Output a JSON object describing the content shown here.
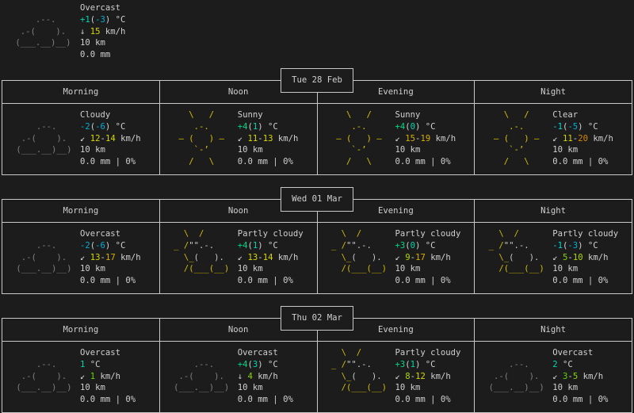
{
  "colors": {
    "background": "#1c1c1c",
    "text": "#d0d0d0",
    "border": "#c8c8c8",
    "cloud": "#808080",
    "sun": "#d7c000"
  },
  "icons": {
    "cloud": {
      "color": "#808080",
      "lines": [
        "             ",
        "     .--.    ",
        "  .-(    ).  ",
        " (___.__)__) ",
        "             "
      ]
    },
    "sun": {
      "color": "#d7c000",
      "lines": [
        "    \\   /    ",
        "     .-.     ",
        "  ― (   ) ―  ",
        "     `-’     ",
        "    /   \\    "
      ]
    },
    "partly-cloudy": {
      "color": "#d7c000",
      "cloud": "#d0d0d0",
      "lines": [
        "   \\  /      ",
        " _ /\"\".-.    ",
        "   \\_(   ).  ",
        "   /(___(__) ",
        "             "
      ]
    }
  },
  "current": {
    "icon": "cloud",
    "condition": "Overcast",
    "temp": [
      [
        "+1",
        "#00d7af"
      ],
      [
        "(",
        null
      ],
      [
        "-3",
        "#00afd7"
      ],
      [
        ") °C",
        null
      ]
    ],
    "wind_arrow": "↓",
    "wind": [
      [
        "15",
        "#d7d700"
      ]
    ],
    "wind_unit": " km/h",
    "visibility": "10 km",
    "precip": "0.0 mm"
  },
  "headers": [
    "Morning",
    "Noon",
    "Evening",
    "Night"
  ],
  "days": [
    {
      "date": "Tue 28 Feb",
      "periods": [
        {
          "icon": "cloud",
          "condition": "Cloudy",
          "temp": [
            [
              "-2",
              "#00afd7"
            ],
            [
              "(",
              null
            ],
            [
              "-6",
              "#00afd7"
            ],
            [
              ") °C",
              null
            ]
          ],
          "wind_arrow": "↙",
          "wind": [
            [
              "12",
              "#d7d700"
            ],
            [
              "-",
              null
            ],
            [
              "14",
              "#d7d700"
            ]
          ],
          "visibility": "10 km",
          "precip": "0.0 mm | 0%"
        },
        {
          "icon": "sun",
          "condition": "Sunny",
          "temp": [
            [
              "+4",
              "#00d787"
            ],
            [
              "(",
              null
            ],
            [
              "1",
              "#00d7af"
            ],
            [
              ") °C",
              null
            ]
          ],
          "wind_arrow": "↙",
          "wind": [
            [
              "11",
              "#d7d700"
            ],
            [
              "-",
              null
            ],
            [
              "13",
              "#d7d700"
            ]
          ],
          "visibility": "10 km",
          "precip": "0.0 mm | 0%"
        },
        {
          "icon": "sun",
          "condition": "Sunny",
          "temp": [
            [
              "+4",
              "#00d787"
            ],
            [
              "(",
              null
            ],
            [
              "0",
              "#00d7af"
            ],
            [
              ") °C",
              null
            ]
          ],
          "wind_arrow": "↙",
          "wind": [
            [
              "15",
              "#d7af00"
            ],
            [
              "-",
              null
            ],
            [
              "19",
              "#d7af00"
            ]
          ],
          "visibility": "10 km",
          "precip": "0.0 mm | 0%"
        },
        {
          "icon": "sun",
          "condition": "Clear",
          "temp": [
            [
              "-1",
              "#00d7d7"
            ],
            [
              "(",
              null
            ],
            [
              "-5",
              "#00afd7"
            ],
            [
              ") °C",
              null
            ]
          ],
          "wind_arrow": "↙",
          "wind": [
            [
              "11",
              "#d7d700"
            ],
            [
              "-",
              null
            ],
            [
              "20",
              "#d78700"
            ]
          ],
          "visibility": "10 km",
          "precip": "0.0 mm | 0%"
        }
      ]
    },
    {
      "date": "Wed 01 Mar",
      "periods": [
        {
          "icon": "cloud",
          "condition": "Overcast",
          "temp": [
            [
              "-2",
              "#00afd7"
            ],
            [
              "(",
              null
            ],
            [
              "-6",
              "#00afd7"
            ],
            [
              ") °C",
              null
            ]
          ],
          "wind_arrow": "↙",
          "wind": [
            [
              "13",
              "#d7d700"
            ],
            [
              "-",
              null
            ],
            [
              "17",
              "#d7af00"
            ]
          ],
          "visibility": "10 km",
          "precip": "0.0 mm | 0%"
        },
        {
          "icon": "partly-cloudy",
          "condition": "Partly cloudy",
          "temp": [
            [
              "+4",
              "#00d787"
            ],
            [
              "(",
              null
            ],
            [
              "1",
              "#00d7af"
            ],
            [
              ") °C",
              null
            ]
          ],
          "wind_arrow": "↙",
          "wind": [
            [
              "13",
              "#d7d700"
            ],
            [
              "-",
              null
            ],
            [
              "14",
              "#d7d700"
            ]
          ],
          "visibility": "10 km",
          "precip": "0.0 mm | 0%"
        },
        {
          "icon": "partly-cloudy",
          "condition": "Partly cloudy",
          "temp": [
            [
              "+3",
              "#00d787"
            ],
            [
              "(",
              null
            ],
            [
              "0",
              "#00d7af"
            ],
            [
              ") °C",
              null
            ]
          ],
          "wind_arrow": "↙",
          "wind": [
            [
              "9",
              "#afd700"
            ],
            [
              "-",
              null
            ],
            [
              "17",
              "#d7af00"
            ]
          ],
          "visibility": "10 km",
          "precip": "0.0 mm | 0%"
        },
        {
          "icon": "partly-cloudy",
          "condition": "Partly cloudy",
          "temp": [
            [
              "-1",
              "#00d7d7"
            ],
            [
              "(",
              null
            ],
            [
              "-3",
              "#00afd7"
            ],
            [
              ") °C",
              null
            ]
          ],
          "wind_arrow": "↙",
          "wind": [
            [
              "5",
              "#87d700"
            ],
            [
              "-",
              null
            ],
            [
              "10",
              "#afd700"
            ]
          ],
          "visibility": "10 km",
          "precip": "0.0 mm | 0%"
        }
      ]
    },
    {
      "date": "Thu 02 Mar",
      "periods": [
        {
          "icon": "cloud",
          "condition": "Overcast",
          "temp": [
            [
              "1",
              "#00d7af"
            ],
            [
              " °C",
              null
            ]
          ],
          "wind_arrow": "↙",
          "wind": [
            [
              "1",
              "#5fd700"
            ]
          ],
          "visibility": "10 km",
          "precip": "0.0 mm | 0%"
        },
        {
          "icon": "cloud",
          "condition": "Overcast",
          "temp": [
            [
              "+4",
              "#00d787"
            ],
            [
              "(",
              null
            ],
            [
              "3",
              "#00d7af"
            ],
            [
              ") °C",
              null
            ]
          ],
          "wind_arrow": "↓",
          "wind": [
            [
              "4",
              "#87d700"
            ]
          ],
          "visibility": "10 km",
          "precip": "0.0 mm | 0%"
        },
        {
          "icon": "partly-cloudy",
          "condition": "Partly cloudy",
          "temp": [
            [
              "+3",
              "#00d787"
            ],
            [
              "(",
              null
            ],
            [
              "1",
              "#00d7af"
            ],
            [
              ") °C",
              null
            ]
          ],
          "wind_arrow": "↙",
          "wind": [
            [
              "8",
              "#afd700"
            ],
            [
              "-",
              null
            ],
            [
              "12",
              "#d7d700"
            ]
          ],
          "visibility": "10 km",
          "precip": "0.0 mm | 0%"
        },
        {
          "icon": "cloud",
          "condition": "Overcast",
          "temp": [
            [
              "2",
              "#00d7af"
            ],
            [
              " °C",
              null
            ]
          ],
          "wind_arrow": "↙",
          "wind": [
            [
              "3",
              "#5fd700"
            ],
            [
              "-",
              null
            ],
            [
              "5",
              "#87d700"
            ]
          ],
          "visibility": "10 km",
          "precip": "0.0 mm | 0%"
        }
      ]
    }
  ]
}
